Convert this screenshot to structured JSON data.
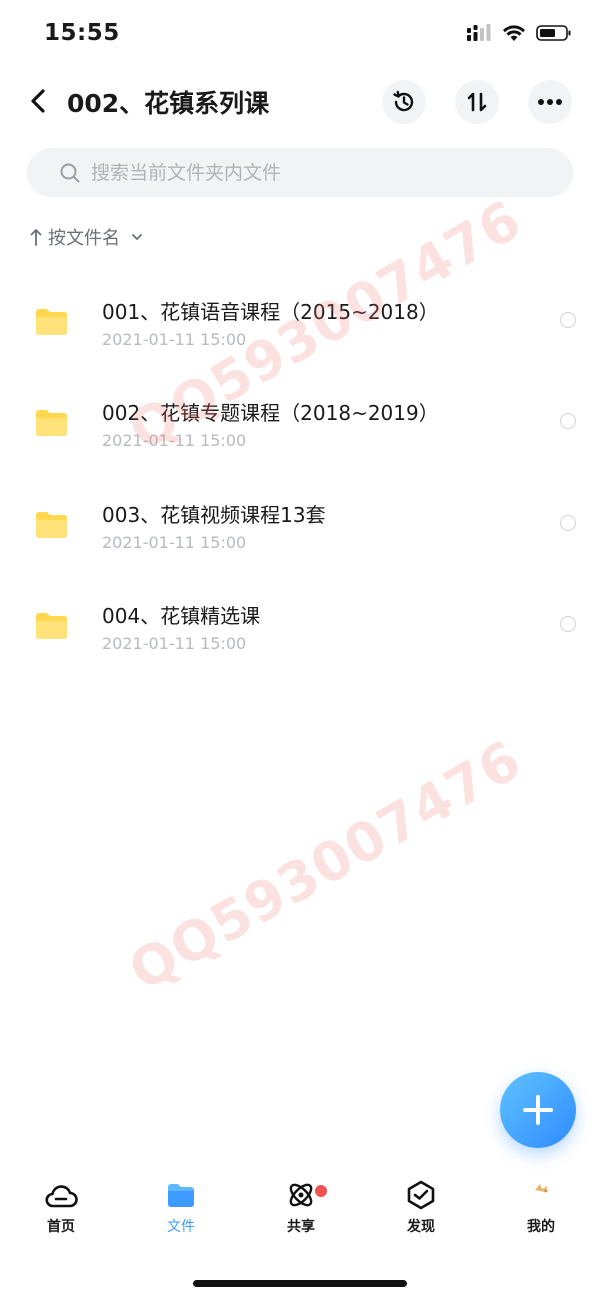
{
  "status_bar": {
    "time": "15:55"
  },
  "header": {
    "title": "002、花镇系列课"
  },
  "search": {
    "placeholder": "搜索当前文件夹内文件"
  },
  "sort": {
    "label": "按文件名"
  },
  "files": [
    {
      "name": "001、花镇语音课程（2015~2018）",
      "date": "2021-01-11 15:00"
    },
    {
      "name": "002、花镇专题课程（2018~2019）",
      "date": "2021-01-11 15:00"
    },
    {
      "name": "003、花镇视频课程13套",
      "date": "2021-01-11 15:00"
    },
    {
      "name": "004、花镇精选课",
      "date": "2021-01-11 15:00"
    }
  ],
  "watermark": {
    "text": "QQ593007476"
  },
  "tabs": [
    {
      "label": "首页",
      "icon": "cloud-icon"
    },
    {
      "label": "文件",
      "icon": "folder-icon"
    },
    {
      "label": "共享",
      "icon": "share-orbit-icon"
    },
    {
      "label": "发现",
      "icon": "discover-icon"
    },
    {
      "label": "我的",
      "icon": "avatar-icon"
    }
  ],
  "colors": {
    "accent": "#3d9bff",
    "folder": "#ffd84d",
    "badge": "#f0524f",
    "watermark": "#f07878"
  }
}
